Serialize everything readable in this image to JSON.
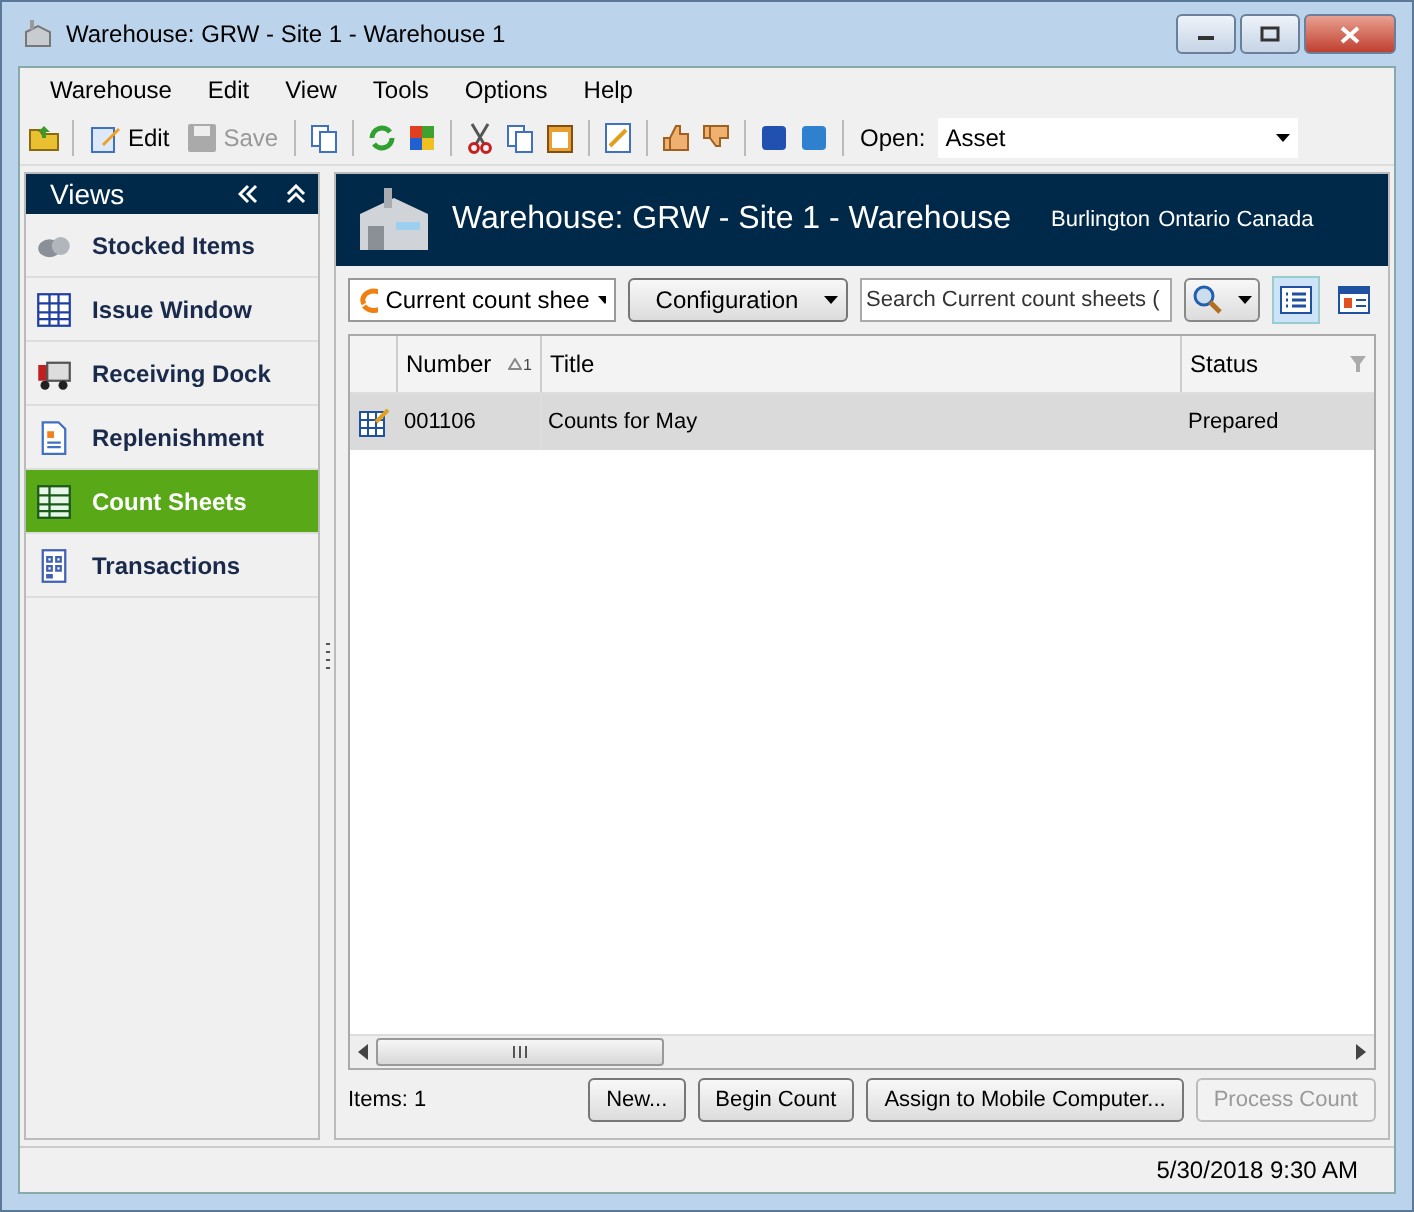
{
  "window": {
    "title": "Warehouse: GRW - Site 1 - Warehouse 1"
  },
  "menu": [
    "Warehouse",
    "Edit",
    "View",
    "Tools",
    "Options",
    "Help"
  ],
  "toolbar": {
    "edit": {
      "label": "Edit",
      "disabled": false
    },
    "save": {
      "label": "Save",
      "disabled": true
    },
    "open": {
      "label": "Open:",
      "value": "Asset"
    }
  },
  "sidebar": {
    "title": "Views",
    "items": [
      {
        "label": "Stocked Items",
        "selected": false
      },
      {
        "label": "Issue Window",
        "selected": false
      },
      {
        "label": "Receiving Dock",
        "selected": false
      },
      {
        "label": "Replenishment",
        "selected": false
      },
      {
        "label": "Count Sheets",
        "selected": true
      },
      {
        "label": "Transactions",
        "selected": false
      }
    ]
  },
  "header": {
    "title": "Warehouse: GRW - Site 1 - Warehouse",
    "location_1": "Burlington",
    "location_2": "Ontario Canada"
  },
  "filters": {
    "view": "Current count shee",
    "configuration": "Configuration",
    "search": {
      "placeholder": "Search Current count sheets ("
    }
  },
  "table": {
    "columns": [
      {
        "label": "Number",
        "sort": "1"
      },
      {
        "label": "Title"
      },
      {
        "label": "Status"
      }
    ],
    "rows": [
      {
        "number": "001106",
        "title": "Counts for May",
        "status": "Prepared",
        "selected": true
      }
    ]
  },
  "footer": {
    "count": "Items: 1",
    "buttons": [
      {
        "label": "New...",
        "disabled": false
      },
      {
        "label": "Begin Count",
        "disabled": false
      },
      {
        "label": "Assign to Mobile Computer...",
        "disabled": false
      },
      {
        "label": "Process Count",
        "disabled": true
      }
    ]
  },
  "status_bar": {
    "datetime": "5/30/2018 9:30 AM"
  }
}
